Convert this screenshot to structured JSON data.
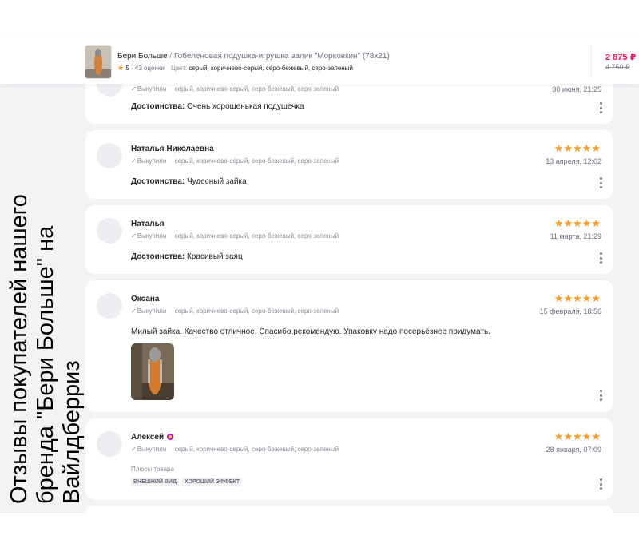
{
  "product": {
    "brand": "Бери Больше",
    "separator": "/",
    "name": "Гобеленовая подушка-игрушка валик \"Морковкин\" (78x21)",
    "rating": "5",
    "reviews_count": "43 оценки",
    "color_label": "Цвет:",
    "colors": "серый, коричнево-серый, серо-бежевый, серо-зеленый",
    "price": "2 875 ₽",
    "old_price": "4 750 ₽"
  },
  "reviews": [
    {
      "name": "",
      "bought": "Выкупили",
      "colors": "серый, коричнево-серый, серо-бежевый, серо-зеленый",
      "date": "30 июня, 21:25",
      "label": "Достоинства:",
      "text": "Очень хорошенькая подушечка",
      "stars": 5
    },
    {
      "name": "Наталья Николаевна",
      "bought": "Выкупили",
      "colors": "серый, коричнево-серый, серо-бежевый, серо-зеленый",
      "date": "13 апреля, 12:02",
      "label": "Достоинства:",
      "text": "Чудесный зайка",
      "stars": 5
    },
    {
      "name": "Наталья",
      "bought": "Выкупили",
      "colors": "серый, коричнево-серый, серо-бежевый, серо-зеленый",
      "date": "11 марта, 21:29",
      "label": "Достоинства:",
      "text": "Красивый заяц",
      "stars": 5
    },
    {
      "name": "Оксана",
      "bought": "Выкупили",
      "colors": "серый, коричнево-серый, серо-бежевый, серо-зеленый",
      "date": "15 февраля, 18:56",
      "text": "Милый зайка. Качество отличное. Спасибо,рекомендую. Упаковку надо посерьёзнее придумать.",
      "stars": 5
    },
    {
      "name": "Алексей",
      "bought": "Выкупили",
      "colors": "серый, коричнево-серый, серо-бежевый, серо-зеленый",
      "date": "28 января, 07:09",
      "pros_label": "Плюсы товара",
      "tags": [
        "ВНЕШНИЙ ВИД",
        "ХОРОШИЙ ЭФФЕКТ"
      ],
      "stars": 5
    }
  ],
  "caption": "Отзывы покупателей нашего бренда \"Бери Больше\" на Вайлдберриз",
  "colors": {
    "accent_price": "#f91155",
    "star": "#ff9a1f",
    "page_bg": "#f3f3f6"
  }
}
